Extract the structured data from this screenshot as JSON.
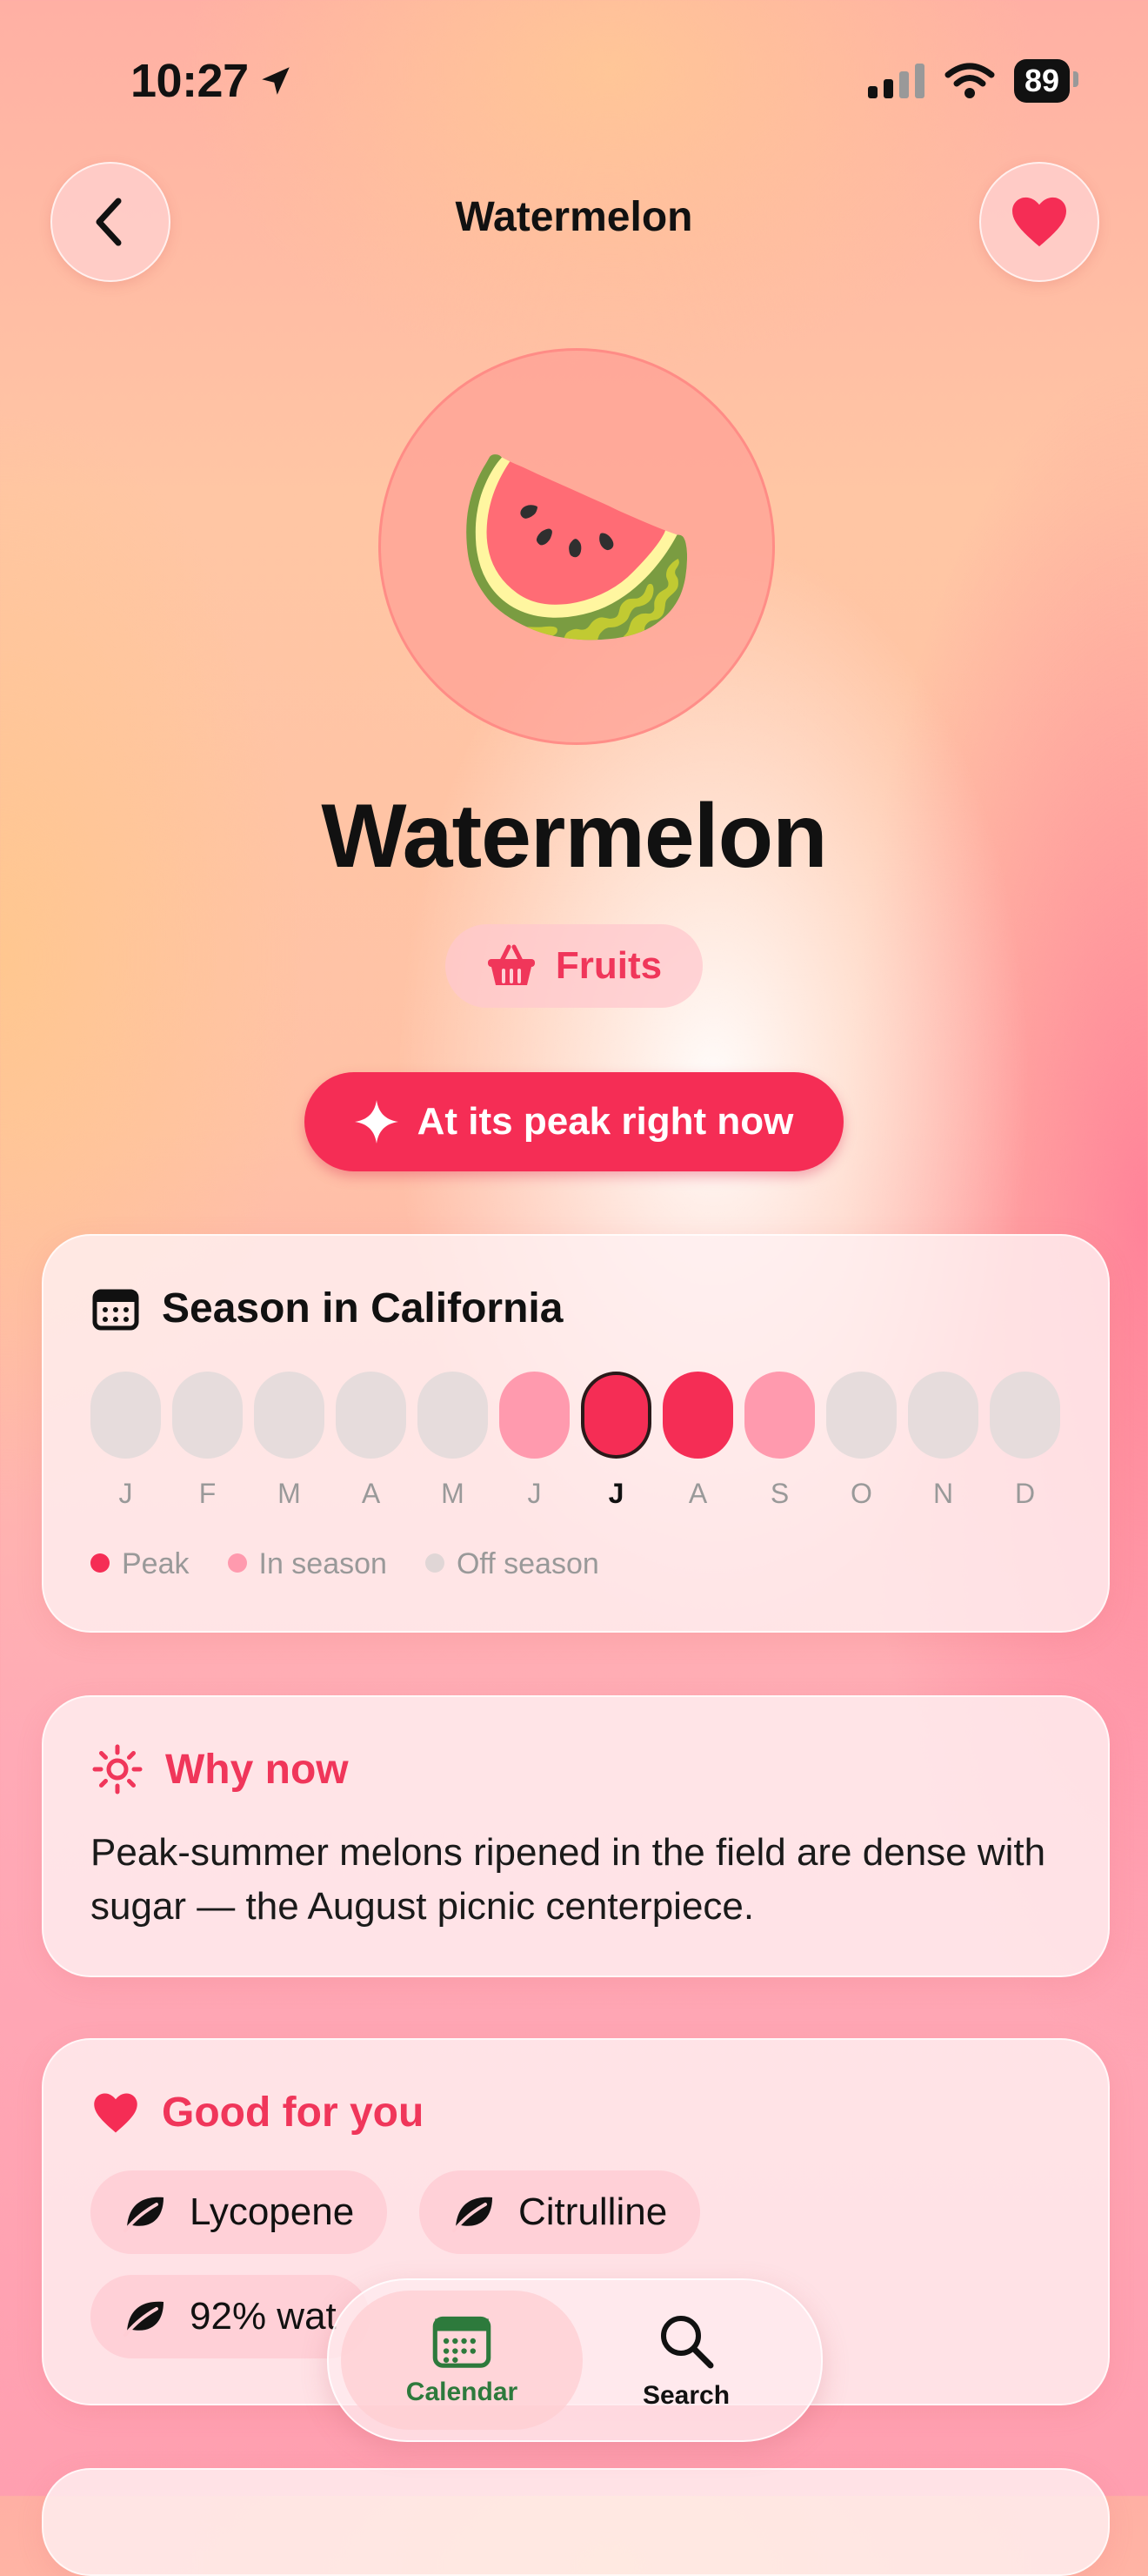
{
  "status": {
    "time": "10:27",
    "battery": "89"
  },
  "nav": {
    "title": "Watermelon"
  },
  "hero": {
    "emoji": "🍉",
    "name": "Watermelon"
  },
  "category": {
    "label": "Fruits"
  },
  "peak_badge": {
    "label": "At its peak right now"
  },
  "season": {
    "title": "Season in California",
    "months": [
      {
        "letter": "J",
        "status": "off"
      },
      {
        "letter": "F",
        "status": "off"
      },
      {
        "letter": "M",
        "status": "off"
      },
      {
        "letter": "A",
        "status": "off"
      },
      {
        "letter": "M",
        "status": "off"
      },
      {
        "letter": "J",
        "status": "in"
      },
      {
        "letter": "J",
        "status": "peak",
        "current": true
      },
      {
        "letter": "A",
        "status": "peak"
      },
      {
        "letter": "S",
        "status": "in"
      },
      {
        "letter": "O",
        "status": "off"
      },
      {
        "letter": "N",
        "status": "off"
      },
      {
        "letter": "D",
        "status": "off"
      }
    ],
    "legend": {
      "peak": "Peak",
      "in_season": "In season",
      "off_season": "Off season"
    }
  },
  "why_now": {
    "title": "Why now",
    "text": "Peak-summer melons ripened in the field are dense with sugar — the August picnic centerpiece."
  },
  "good_for_you": {
    "title": "Good for you",
    "chips": [
      "Lycopene",
      "Citrulline",
      "92% wat"
    ]
  },
  "tabs": {
    "calendar": "Calendar",
    "search": "Search"
  },
  "colors": {
    "accent": "#f52d55",
    "in_season": "#ff9aae",
    "off_season": "#e6dcdc",
    "active_tab": "#2d7a3c"
  }
}
